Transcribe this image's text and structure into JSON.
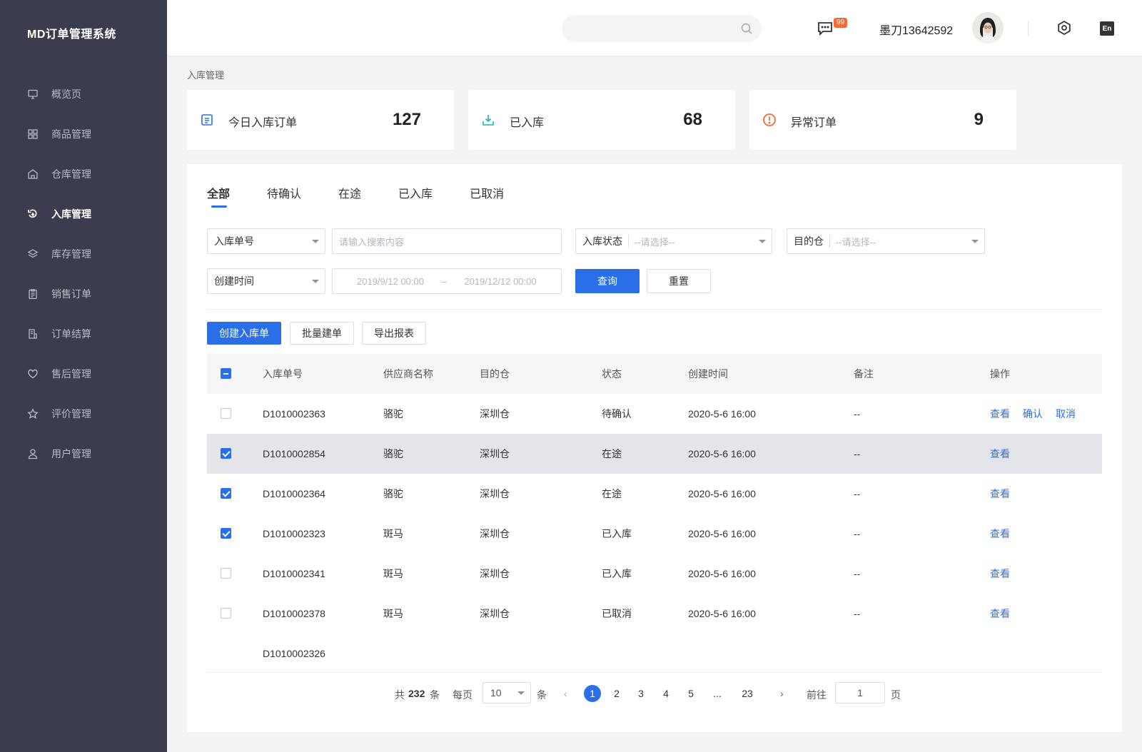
{
  "app": {
    "title": "MD订单管理系统"
  },
  "sidebar": {
    "items": [
      {
        "label": "概览页",
        "icon": "monitor-icon"
      },
      {
        "label": "商品管理",
        "icon": "grid-icon"
      },
      {
        "label": "仓库管理",
        "icon": "warehouse-icon"
      },
      {
        "label": "入库管理",
        "icon": "inbound-icon"
      },
      {
        "label": "库存管理",
        "icon": "layers-icon"
      },
      {
        "label": "销售订单",
        "icon": "clipboard-icon"
      },
      {
        "label": "订单结算",
        "icon": "settlement-icon"
      },
      {
        "label": "售后管理",
        "icon": "heart-icon"
      },
      {
        "label": "评价管理",
        "icon": "star-icon"
      },
      {
        "label": "用户管理",
        "icon": "user-icon"
      }
    ],
    "active_index": 3
  },
  "header": {
    "search_placeholder": "",
    "message_badge": "99",
    "username": "墨刀13642592",
    "lang": "En"
  },
  "breadcrumb": "入库管理",
  "stats": [
    {
      "label": "今日入库订单",
      "value": "127",
      "icon": "document-icon",
      "color": "#2a6ee8"
    },
    {
      "label": "已入库",
      "value": "68",
      "icon": "download-tray-icon",
      "color": "#1bb6b0"
    },
    {
      "label": "异常订单",
      "value": "9",
      "icon": "alert-circle-icon",
      "color": "#f26b3a"
    }
  ],
  "tabs": [
    "全部",
    "待确认",
    "在途",
    "已入库",
    "已取消"
  ],
  "filters": {
    "order_no_select": "入库单号",
    "search_placeholder": "请输入搜索内容",
    "status_label": "入库状态",
    "status_placeholder": "--请选择--",
    "dest_label": "目的仓",
    "dest_placeholder": "--请选择--",
    "time_select": "创建时间",
    "date_start": "2019/9/12 00:00",
    "date_sep": "–",
    "date_end": "2019/12/12 00:00",
    "query_btn": "查询",
    "reset_btn": "重置"
  },
  "actions": {
    "create": "创建入库单",
    "batch": "批量建单",
    "export": "导出报表"
  },
  "table": {
    "columns": [
      "入库单号",
      "供应商名称",
      "目的仓",
      "状态",
      "创建时间",
      "备注",
      "操作"
    ],
    "rows": [
      {
        "id": "D1010002363",
        "supplier": "骆驼",
        "warehouse": "深圳仓",
        "status": "待确认",
        "time": "2020-5-6  16:00",
        "note": "--",
        "checked": false,
        "ops": [
          "查看",
          "确认",
          "取消"
        ]
      },
      {
        "id": "D1010002854",
        "supplier": "骆驼",
        "warehouse": "深圳仓",
        "status": "在途",
        "time": "2020-5-6  16:00",
        "note": "--",
        "checked": true,
        "ops": [
          "查看"
        ]
      },
      {
        "id": "D1010002364",
        "supplier": "骆驼",
        "warehouse": "深圳仓",
        "status": "在途",
        "time": "2020-5-6  16:00",
        "note": "--",
        "checked": true,
        "ops": [
          "查看"
        ]
      },
      {
        "id": "D1010002323",
        "supplier": "斑马",
        "warehouse": "深圳仓",
        "status": "已入库",
        "time": "2020-5-6  16:00",
        "note": "--",
        "checked": true,
        "ops": [
          "查看"
        ]
      },
      {
        "id": "D1010002341",
        "supplier": "斑马",
        "warehouse": "深圳仓",
        "status": "已入库",
        "time": "2020-5-6  16:00",
        "note": "--",
        "checked": false,
        "ops": [
          "查看"
        ]
      },
      {
        "id": "D1010002378",
        "supplier": "斑马",
        "warehouse": "深圳仓",
        "status": "已取消",
        "time": "2020-5-6  16:00",
        "note": "--",
        "checked": false,
        "ops": [
          "查看"
        ]
      }
    ],
    "partial_row_id": "D1010002326"
  },
  "pagination": {
    "total_prefix": "共",
    "total": "232",
    "total_suffix": "条",
    "per_page_label": "每页",
    "per_page": "10",
    "per_page_suffix": "条",
    "pages": [
      "1",
      "2",
      "3",
      "4",
      "5",
      "...",
      "23"
    ],
    "current": "1",
    "goto_label": "前往",
    "goto_value": "1",
    "goto_suffix": "页"
  }
}
